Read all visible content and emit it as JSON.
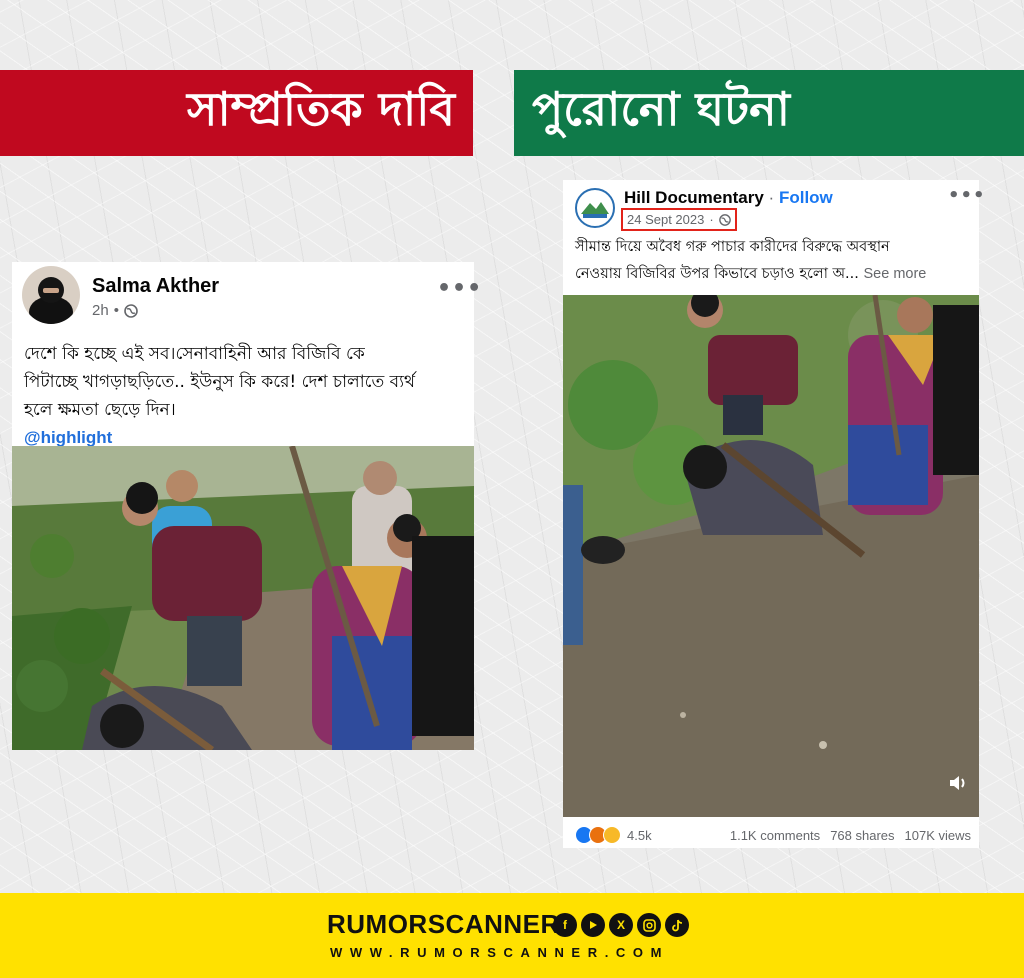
{
  "banners": {
    "left_title": "সাম্প্রতিক দাবি",
    "right_title": "পুরোনো ঘটনা"
  },
  "left_post": {
    "author": "Salma Akther",
    "time": "2h",
    "more": "•••",
    "text_lines": [
      "দেশে কি হচ্ছে এই সব।সেনাবাহিনী আর বিজিবি কে",
      "পিটাচ্ছে খাগড়াছড়িতে.. ইউনুস কি করে! দেশ চালাতে ব্যর্থ",
      "হলে ক্ষমতা ছেড়ে দিন।"
    ],
    "hashtag": "@highlight"
  },
  "right_post": {
    "author": "Hill Documentary",
    "separator": "·",
    "follow": "Follow",
    "date": "24 Sept 2023",
    "more": "•••",
    "text_line1": "সীমান্ত দিয়ে অবৈধ গরু পাচার কারীদের বিরুদ্ধে অবস্থান",
    "text_line2": "নেওয়ায়  বিজিবির উপর কিভাবে চড়াও হলো অ...",
    "see_more": "See more",
    "reactions": "4.5k",
    "comments": "1.1K comments",
    "shares": "768 shares",
    "views": "107K views"
  },
  "footer": {
    "brand": "RUMORSCANNER",
    "website": "WWW.RUMORSCANNER.COM",
    "social_icons": [
      "facebook-icon",
      "youtube-icon",
      "x-icon",
      "instagram-icon",
      "tiktok-icon"
    ]
  },
  "colors": {
    "red_banner": "#c0091f",
    "green_banner": "#0f7a49",
    "footer_yellow": "#ffe100",
    "highlight_box": "#e2231a",
    "link_blue": "#1877f2"
  }
}
